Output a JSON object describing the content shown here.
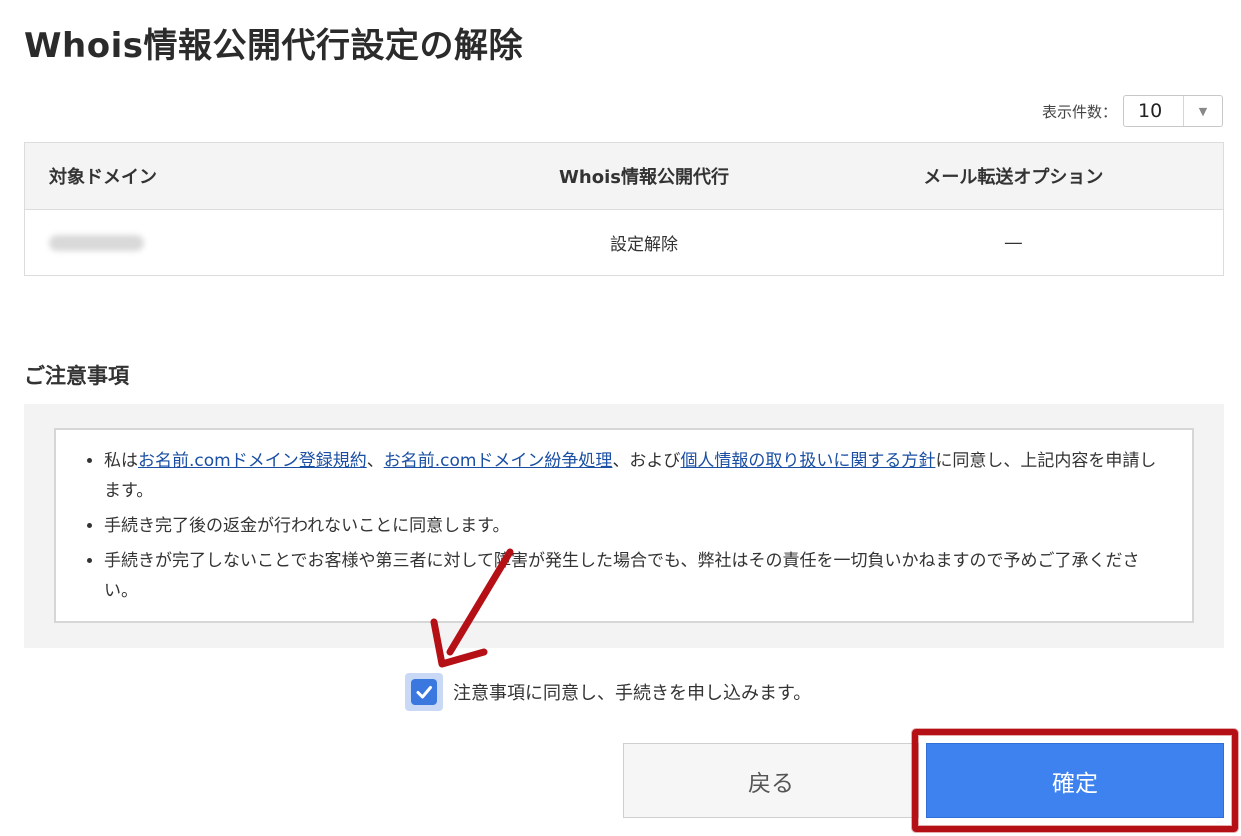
{
  "page": {
    "title": "Whois情報公開代行設定の解除"
  },
  "per_page": {
    "label": "表示件数：",
    "value": "10",
    "icon": "chevron-down-icon"
  },
  "table": {
    "headers": {
      "domain": "対象ドメイン",
      "whois": "Whois情報公開代行",
      "mail": "メール転送オプション"
    },
    "rows": [
      {
        "domain": "",
        "whois": "設定解除",
        "mail": "―"
      }
    ]
  },
  "notes": {
    "heading": "ご注意事項",
    "item1": {
      "prefix": "私は",
      "link1": "お名前.comドメイン登録規約",
      "sep1": "、",
      "link2": "お名前.comドメイン紛争処理",
      "sep2": "、および",
      "link3": "個人情報の取り扱いに関する方針",
      "suffix": "に同意し、上記内容を申請します。"
    },
    "item2": "手続き完了後の返金が行われないことに同意します。",
    "item3": "手続きが完了しないことでお客様や第三者に対して障害が発生した場合でも、弊社はその責任を一切負いかねますので予めご了承ください。"
  },
  "agreement": {
    "label": "注意事項に同意し、手続きを申し込みます。",
    "checked": true
  },
  "buttons": {
    "back": "戻る",
    "confirm": "確定"
  },
  "colors": {
    "accent": "#3e82f0",
    "annotation": "#b41016",
    "link": "#1a4fa3"
  }
}
